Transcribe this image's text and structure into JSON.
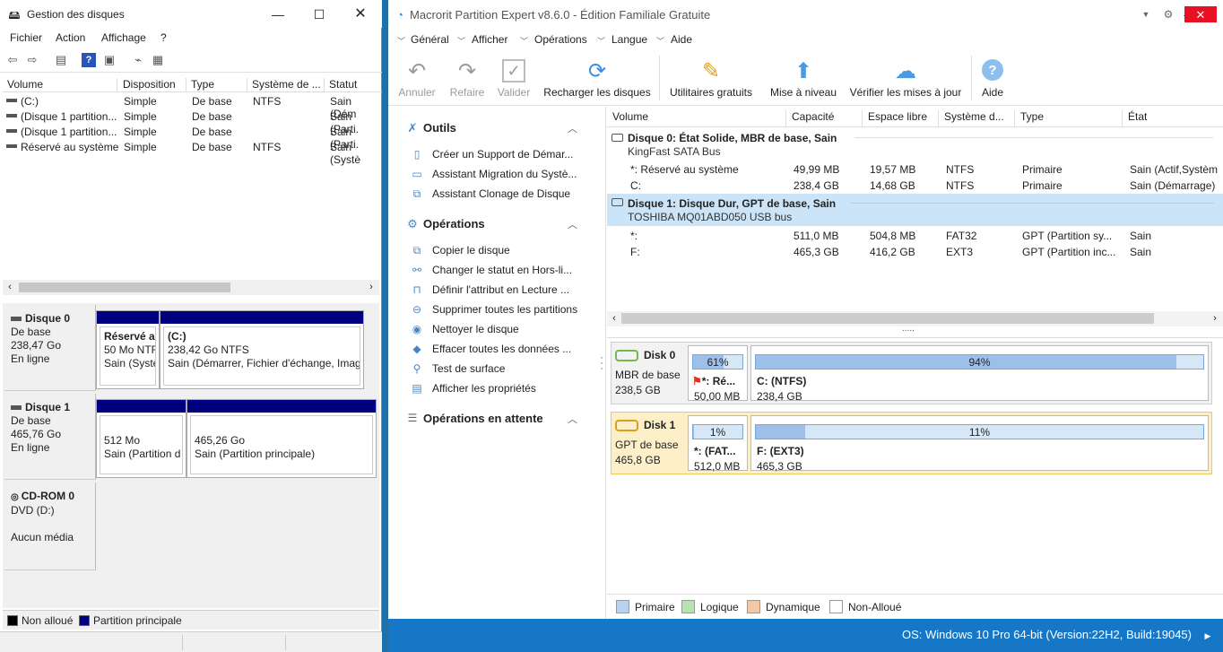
{
  "dm": {
    "title": "Gestion des disques",
    "menu": [
      "Fichier",
      "Action",
      "Affichage",
      "?"
    ],
    "columns": [
      "Volume",
      "Disposition",
      "Type",
      "Système de ...",
      "Statut"
    ],
    "rows": [
      {
        "volume": "(C:)",
        "layout": "Simple",
        "type": "De base",
        "fs": "NTFS",
        "status": "Sain (Dém"
      },
      {
        "volume": "(Disque 1 partition...",
        "layout": "Simple",
        "type": "De base",
        "fs": "",
        "status": "Sain (Parti."
      },
      {
        "volume": "(Disque 1 partition...",
        "layout": "Simple",
        "type": "De base",
        "fs": "",
        "status": "Sain (Parti."
      },
      {
        "volume": "Réservé au système",
        "layout": "Simple",
        "type": "De base",
        "fs": "NTFS",
        "status": "Sain (Systè"
      }
    ],
    "disks": [
      {
        "name": "Disque 0",
        "l1": "De base",
        "l2": "238,47 Go",
        "l3": "En ligne",
        "parts": [
          {
            "title": "Réservé a",
            "l1": "50 Mo NTF",
            "l2": "Sain (Systè"
          },
          {
            "title": "(C:)",
            "l1": "238,42 Go NTFS",
            "l2": "Sain (Démarrer, Fichier d'échange, Imag"
          }
        ]
      },
      {
        "name": "Disque 1",
        "l1": "De base",
        "l2": "465,76 Go",
        "l3": "En ligne",
        "parts": [
          {
            "title": "",
            "l1": "512 Mo",
            "l2": "Sain (Partition d"
          },
          {
            "title": "",
            "l1": "465,26 Go",
            "l2": "Sain (Partition principale)"
          }
        ]
      },
      {
        "name": "CD-ROM 0",
        "l1": "DVD (D:)",
        "l2": "",
        "l3": "Aucun média"
      }
    ],
    "legend": [
      "Non alloué",
      "Partition principale"
    ],
    "legend_colors": [
      "#000000",
      "#000080"
    ]
  },
  "mc": {
    "title": "Macrorit Partition Expert v8.6.0 - Édition Familiale Gratuite",
    "menu": [
      "Général",
      "Afficher",
      "Opérations",
      "Langue",
      "Aide"
    ],
    "ribbon": [
      "Annuler",
      "Refaire",
      "Valider",
      "Recharger les disques",
      "Utilitaires gratuits",
      "Mise à niveau",
      "Vérifier les mises à jour",
      "Aide"
    ],
    "side": {
      "outils": "Outils",
      "outils_items": [
        "Créer un Support de Démar...",
        "Assistant Migration du Systè...",
        "Assistant Clonage de Disque"
      ],
      "ops": "Opérations",
      "ops_items": [
        "Copier le disque",
        "Changer le statut en Hors-li...",
        "Définir l'attribut en Lecture ...",
        "Supprimer toutes les partitions",
        "Nettoyer le disque",
        "Effacer toutes les données ...",
        "Test de surface",
        "Afficher les propriétés"
      ],
      "pending": "Opérations en attente"
    },
    "columns": [
      "Volume",
      "Capacité",
      "Espace libre",
      "Système d...",
      "Type",
      "État"
    ],
    "disk0": {
      "title": "Disque 0: État Solide, MBR de base, Sain",
      "sub": "KingFast SATA Bus"
    },
    "disk0_rows": [
      {
        "vol": "*: Réservé au système",
        "cap": "49,99 MB",
        "free": "19,57 MB",
        "fs": "NTFS",
        "type": "Primaire",
        "state": "Sain (Actif,Systèm"
      },
      {
        "vol": "C:",
        "cap": "238,4 GB",
        "free": "14,68 GB",
        "fs": "NTFS",
        "type": "Primaire",
        "state": "Sain (Démarrage)"
      }
    ],
    "disk1": {
      "title": "Disque 1: Disque Dur, GPT de base, Sain",
      "sub": "TOSHIBA MQ01ABD050 USB bus"
    },
    "disk1_rows": [
      {
        "vol": "*:",
        "cap": "511,0 MB",
        "free": "504,8 MB",
        "fs": "FAT32",
        "type": "GPT (Partition sy...",
        "state": "Sain"
      },
      {
        "vol": "F:",
        "cap": "465,3 GB",
        "free": "416,2 GB",
        "fs": "EXT3",
        "type": "GPT (Partition inc...",
        "state": "Sain"
      }
    ],
    "maps": [
      {
        "name": "Disk 0",
        "scheme": "MBR de base",
        "size": "238,5 GB",
        "p1": {
          "pct": "61%",
          "fill": 0.61,
          "label": "*: Ré...",
          "size": "50,00 MB"
        },
        "p2": {
          "pct": "94%",
          "fill": 0.94,
          "label": "C: (NTFS)",
          "size": "238,4 GB"
        }
      },
      {
        "name": "Disk 1",
        "scheme": "GPT de base",
        "size": "465,8 GB",
        "p1": {
          "pct": "1%",
          "fill": 0.01,
          "label": "*: (FAT...",
          "size": "512,0 MB"
        },
        "p2": {
          "pct": "11%",
          "fill": 0.11,
          "label": "F: (EXT3)",
          "size": "465,3 GB"
        }
      }
    ],
    "legend": [
      "Primaire",
      "Logique",
      "Dynamique",
      "Non-Alloué"
    ],
    "legend_colors": [
      "#b9d3ef",
      "#b7e3b2",
      "#f2c9a6",
      "#ffffff"
    ],
    "status": "OS: Windows 10 Pro 64-bit (Version:22H2, Build:19045)"
  }
}
